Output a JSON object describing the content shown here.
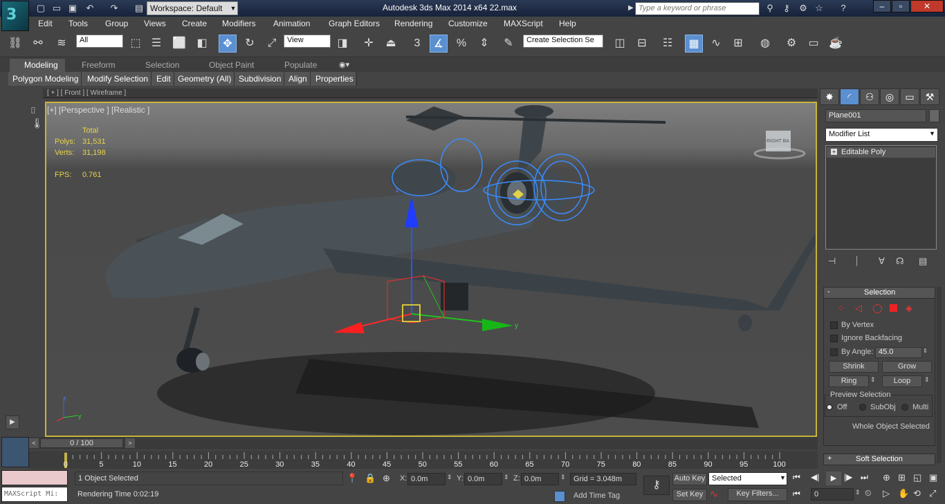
{
  "window": {
    "title": "Autodesk 3ds Max  2014 x64     22.max",
    "workspace": "Workspace: Default",
    "search_placeholder": "Type a keyword or phrase"
  },
  "menu": [
    "Edit",
    "Tools",
    "Group",
    "Views",
    "Create",
    "Modifiers",
    "Animation",
    "Graph Editors",
    "Rendering",
    "Customize",
    "MAXScript",
    "Help"
  ],
  "toolbar": {
    "selection_filter": "All",
    "ref_coord": "View",
    "named_selection": "Create Selection Se",
    "snap_label": "3"
  },
  "ribbon": {
    "tabs": [
      "Modeling",
      "Freeform",
      "Selection",
      "Object Paint",
      "Populate"
    ],
    "buttons": [
      "Polygon Modeling",
      "Modify Selection",
      "Edit",
      "Geometry (All)",
      "Subdivision",
      "Align",
      "Properties"
    ]
  },
  "viewport": {
    "top_label": "[ + ] [ Front ] [ Wireframe ]",
    "label": "[+] [Perspective ] [Realistic ]",
    "stats": {
      "header": "Total",
      "polys_label": "Polys:",
      "polys": "31,531",
      "verts_label": "Verts:",
      "verts": "31,198",
      "fps_label": "FPS:",
      "fps": "0.761"
    },
    "viewcube": "RIGHT  BA"
  },
  "command_panel": {
    "object_name": "Plane001",
    "modifier_list": "Modifier List",
    "stack": "Editable Poly",
    "selection": {
      "title": "Selection",
      "by_vertex": "By Vertex",
      "ignore_backfacing": "Ignore Backfacing",
      "by_angle": "By Angle:",
      "angle": "45.0",
      "shrink": "Shrink",
      "grow": "Grow",
      "ring": "Ring",
      "loop": "Loop",
      "preview_title": "Preview Selection",
      "preview_opts": [
        "Off",
        "SubObj",
        "Multi"
      ],
      "status": "Whole Object Selected"
    },
    "soft_selection": "Soft Selection"
  },
  "timeline": {
    "frame": "0 / 100",
    "ticks": [
      "0",
      "5",
      "10",
      "15",
      "20",
      "25",
      "30",
      "35",
      "40",
      "45",
      "50",
      "55",
      "60",
      "65",
      "70",
      "75",
      "80",
      "85",
      "90",
      "95",
      "100"
    ]
  },
  "status": {
    "maxscript": "MAXScript Mi:",
    "selected": "1 Object Selected",
    "render_time": "Rendering Time  0:02:19",
    "x_label": "X:",
    "x": "0.0m",
    "y_label": "Y:",
    "y": "0.0m",
    "z_label": "Z:",
    "z": "0.0m",
    "grid": "Grid = 3.048m",
    "add_time_tag": "Add Time Tag",
    "auto_key": "Auto Key",
    "set_key": "Set Key",
    "key_mode": "Selected",
    "key_filters": "Key Filters...",
    "frame_field": "0"
  },
  "colors": {
    "accent": "#5a8fd0",
    "viewport_border": "#c8b43c",
    "stats_text": "#e6d34a"
  }
}
